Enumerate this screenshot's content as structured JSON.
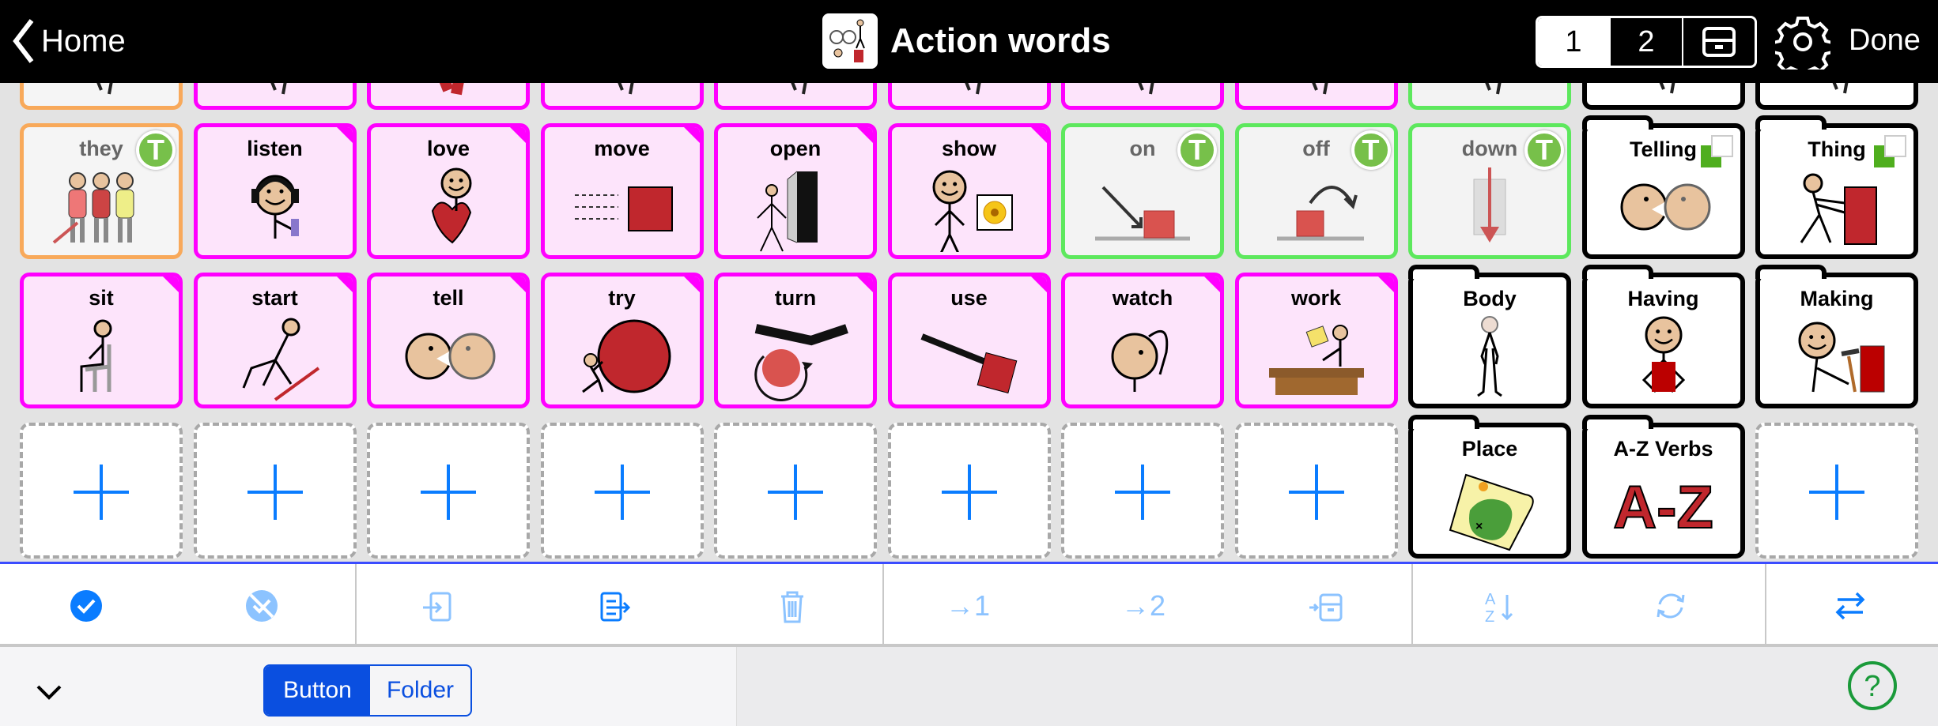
{
  "header": {
    "back_label": "Home",
    "title": "Action words",
    "pages": [
      "1",
      "2"
    ],
    "done_label": "Done"
  },
  "grid": {
    "colors": {
      "verb": "#ff00ff",
      "pronoun": "#f8a95a",
      "preposition": "#5de85d",
      "folder": "#000000",
      "add": "#0a7cff"
    },
    "rows": [
      [
        {
          "type": "orange",
          "label": "",
          "icon": "partial"
        },
        {
          "type": "pink",
          "label": "",
          "icon": "partial"
        },
        {
          "type": "pink",
          "label": "",
          "icon": "partial"
        },
        {
          "type": "pink",
          "label": "",
          "icon": "partial"
        },
        {
          "type": "pink",
          "label": "",
          "icon": "partial"
        },
        {
          "type": "pink",
          "label": "",
          "icon": "partial"
        },
        {
          "type": "pink",
          "label": "",
          "icon": "partial"
        },
        {
          "type": "pink",
          "label": "",
          "icon": "partial"
        },
        {
          "type": "green",
          "label": "",
          "icon": "partial"
        },
        {
          "type": "folder",
          "label": "",
          "icon": "partial"
        },
        {
          "type": "folder",
          "label": "",
          "icon": "partial"
        }
      ],
      [
        {
          "type": "orange",
          "label": "they",
          "icon": "people",
          "badge": "T"
        },
        {
          "type": "pink",
          "label": "listen",
          "icon": "person-headphones"
        },
        {
          "type": "pink",
          "label": "love",
          "icon": "person-heart"
        },
        {
          "type": "pink",
          "label": "move",
          "icon": "square-moving"
        },
        {
          "type": "pink",
          "label": "open",
          "icon": "door"
        },
        {
          "type": "pink",
          "label": "show",
          "icon": "person-flower"
        },
        {
          "type": "green",
          "label": "on",
          "icon": "arrow-on",
          "badge": "T"
        },
        {
          "type": "green",
          "label": "off",
          "icon": "arrow-off",
          "badge": "T"
        },
        {
          "type": "green",
          "label": "down",
          "icon": "arrow-down",
          "badge": "T"
        },
        {
          "type": "folder",
          "label": "Telling",
          "icon": "faces",
          "check": true
        },
        {
          "type": "folder",
          "label": "Thing",
          "icon": "person-push",
          "check": true
        }
      ],
      [
        {
          "type": "pink",
          "label": "sit",
          "icon": "person-sit"
        },
        {
          "type": "pink",
          "label": "start",
          "icon": "person-start"
        },
        {
          "type": "pink",
          "label": "tell",
          "icon": "faces"
        },
        {
          "type": "pink",
          "label": "try",
          "icon": "ball"
        },
        {
          "type": "pink",
          "label": "turn",
          "icon": "turn"
        },
        {
          "type": "pink",
          "label": "use",
          "icon": "use"
        },
        {
          "type": "pink",
          "label": "watch",
          "icon": "person-watch"
        },
        {
          "type": "pink",
          "label": "work",
          "icon": "desk"
        },
        {
          "type": "folder",
          "label": "Body",
          "icon": "body"
        },
        {
          "type": "folder",
          "label": "Having",
          "icon": "person-box"
        },
        {
          "type": "folder",
          "label": "Making",
          "icon": "person-hammer"
        }
      ],
      [
        {
          "type": "empty",
          "label": "",
          "icon": "plus"
        },
        {
          "type": "empty",
          "label": "",
          "icon": "plus"
        },
        {
          "type": "empty",
          "label": "",
          "icon": "plus"
        },
        {
          "type": "empty",
          "label": "",
          "icon": "plus"
        },
        {
          "type": "empty",
          "label": "",
          "icon": "plus"
        },
        {
          "type": "empty",
          "label": "",
          "icon": "plus"
        },
        {
          "type": "empty",
          "label": "",
          "icon": "plus"
        },
        {
          "type": "empty",
          "label": "",
          "icon": "plus"
        },
        {
          "type": "folder",
          "label": "Place",
          "icon": "map"
        },
        {
          "type": "folder",
          "label": "A-Z Verbs",
          "icon": "a-z",
          "icon_text": "A-Z"
        },
        {
          "type": "empty",
          "label": "",
          "icon": "plus"
        }
      ]
    ]
  },
  "toolbar": {
    "active_color": "#0a7cff",
    "disabled_color": "#8cc3ff",
    "items": [
      {
        "icon": "select-all-icon",
        "enabled": true
      },
      {
        "icon": "deselect-icon",
        "enabled": false
      },
      {
        "icon": "import-icon",
        "enabled": false
      },
      {
        "icon": "export-icon",
        "enabled": true
      },
      {
        "icon": "trash-icon",
        "enabled": false
      },
      {
        "icon": "move-to-page-1-icon",
        "label": "→1",
        "enabled": false
      },
      {
        "icon": "move-to-page-2-icon",
        "label": "→2",
        "enabled": false
      },
      {
        "icon": "move-to-tray-icon",
        "enabled": false
      },
      {
        "icon": "sort-az-icon",
        "enabled": false
      },
      {
        "icon": "refresh-icon",
        "enabled": false
      },
      {
        "icon": "swap-icon",
        "enabled": true
      }
    ]
  },
  "bottom": {
    "type_options": [
      "Button",
      "Folder"
    ],
    "selected": "Button",
    "help_color": "#1a9a3a"
  }
}
